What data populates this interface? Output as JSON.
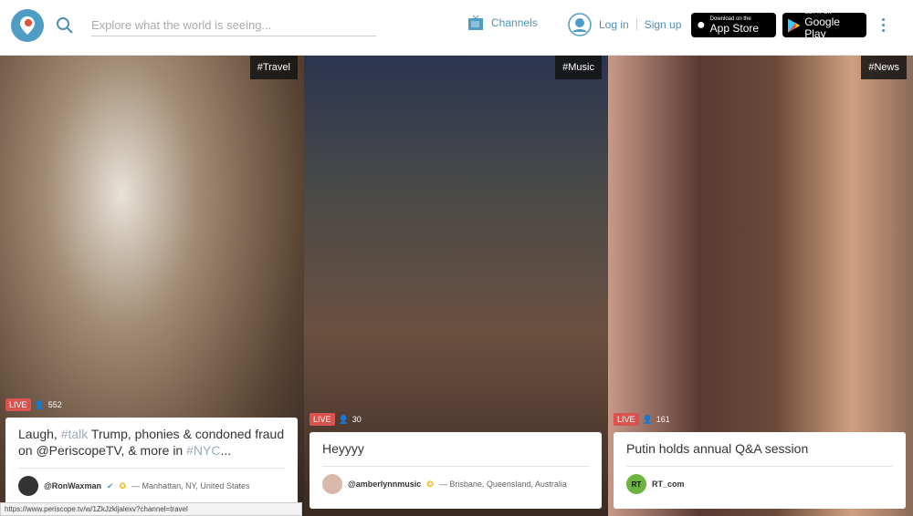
{
  "header": {
    "search_placeholder": "Explore what the world is seeing...",
    "channels": "Channels",
    "login": "Log in",
    "signup": "Sign up",
    "app_store": {
      "small": "Download on the",
      "large": "App Store"
    },
    "google_play": {
      "small": "GET IT ON",
      "large": "Google Play"
    }
  },
  "tiles": [
    {
      "tag": "#Travel",
      "live": "LIVE",
      "viewers": "552",
      "title_parts": [
        "Laugh, ",
        "#talk",
        " Trump, phonies & condoned fraud on @PeriscopeTV, & more in ",
        "#NYC",
        "..."
      ],
      "user": "@RonWaxman",
      "location": "— Manhattan, NY, United States",
      "verified": true
    },
    {
      "tag": "#Music",
      "live": "LIVE",
      "viewers": "30",
      "title": "Heyyyy",
      "user": "@amberlynnmusic",
      "location": "— Brisbane, Queensland, Australia"
    },
    {
      "tag": "#News",
      "live": "LIVE",
      "viewers": "161",
      "title": "Putin holds annual Q&A session",
      "user": "RT_com",
      "avatar_text": "RT"
    }
  ],
  "status_url": "https://www.periscope.tv/w/1ZkJzkljalexv?channel=travel",
  "colors": {
    "accent": "#4f9cc4",
    "live": "#d9534f",
    "rt": "#6cb33f"
  }
}
